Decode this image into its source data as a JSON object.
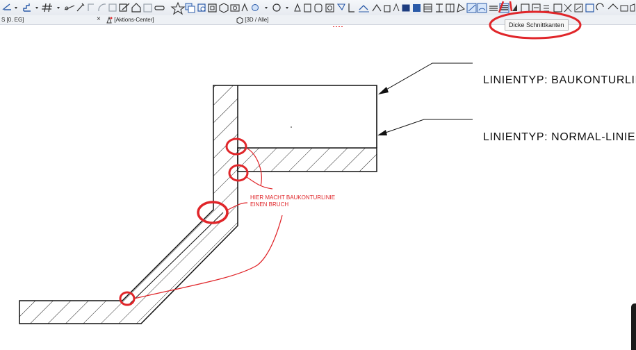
{
  "tabs": [
    {
      "label": "S [0. EG]"
    },
    {
      "label": "[Aktions-Center]"
    },
    {
      "label": "[3D / Alle]"
    }
  ],
  "tooltip": {
    "text": "Dicke Schnittkanten"
  },
  "annotations": {
    "label_top": "LINIENTYP: BAUKONTURLINIE",
    "label_bottom": "LINIENTYP: NORMAL-LINIE",
    "note_line1": "HIER MACHT BAUKONTURLINIE",
    "note_line2": "EINEN BRUCH"
  },
  "colors": {
    "toolbar_icon": "#2a5aa8",
    "markup_red": "#e0262a",
    "line_black": "#111111"
  },
  "icons": [
    "line-tool-icon",
    "dropdown-icon",
    "stair-tool-icon",
    "dropdown-icon",
    "grid-icon",
    "dropdown-icon",
    "measure-icon",
    "magic-wand-icon",
    "trace-icon",
    "arc-icon",
    "rectangle-icon",
    "edit-icon",
    "house-icon",
    "save-icon",
    "link-icon",
    "star-icon",
    "layers-icon",
    "box-icon",
    "frame-icon",
    "cube-icon",
    "camera-icon",
    "marker-icon",
    "pen-icon",
    "circle-icon",
    "dropdown-icon",
    "shape-icon",
    "rotate-icon",
    "cylinder-icon",
    "group-icon",
    "lamp-icon",
    "section-icon",
    "hatch-icon",
    "slab-icon",
    "wall-icon",
    "elevation-icon",
    "thick-cut-edges-icon"
  ]
}
